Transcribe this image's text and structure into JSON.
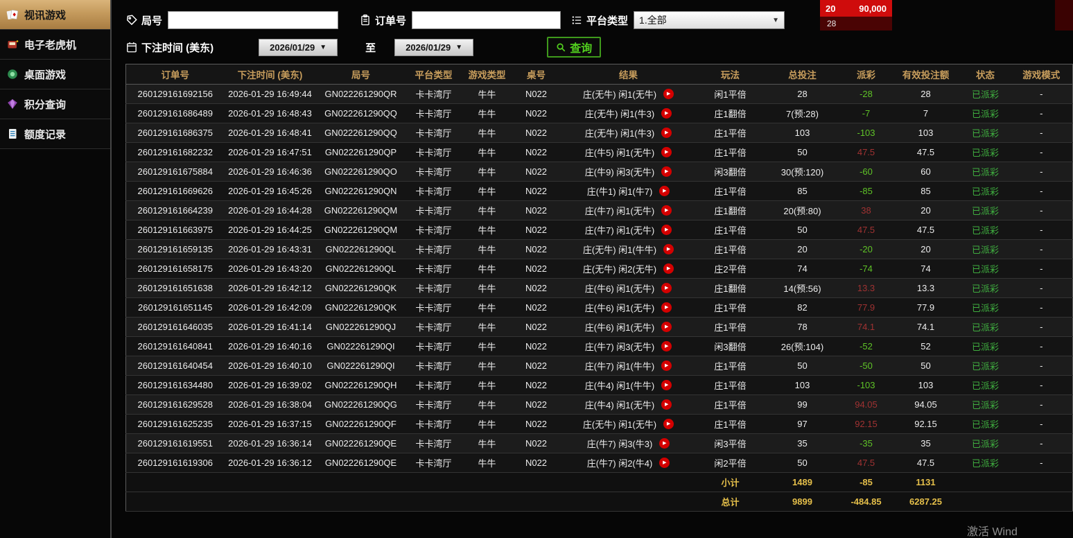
{
  "colors": {
    "accent_gold": "#c79d5c",
    "active_menu_gold": "#c49a5c",
    "win_red": "#a03232",
    "loss_green": "#5fc327",
    "status_green": "#3fae3f",
    "search_green": "#52d01e",
    "play_button_red": "#d40000"
  },
  "sidebar": {
    "items": [
      {
        "label": "视讯游戏"
      },
      {
        "label": "电子老虎机"
      },
      {
        "label": "桌面游戏"
      },
      {
        "label": "积分查询"
      },
      {
        "label": "额度记录"
      }
    ]
  },
  "filters": {
    "round_no_label": "局号",
    "round_no_value": "",
    "order_no_label": "订单号",
    "order_no_value": "",
    "platform_type_label": "平台类型",
    "platform_type_value": "1.全部",
    "bet_time_label": "下注时间 (美东)",
    "date_from": "2026/01/29",
    "to_label": "至",
    "date_to": "2026/01/29",
    "search_button_label": "查询"
  },
  "table": {
    "headers": [
      "订单号",
      "下注时间 (美东)",
      "局号",
      "平台类型",
      "游戏类型",
      "桌号",
      "结果",
      "玩法",
      "总投注",
      "派彩",
      "有效投注额",
      "状态",
      "游戏模式"
    ],
    "column_keys": [
      "order_id",
      "time",
      "round_id",
      "platform",
      "game_type",
      "table_no",
      "result",
      "play_method",
      "total_bet",
      "payout",
      "valid_bet",
      "status",
      "mode"
    ],
    "rows": [
      {
        "order_id": "260129161692156",
        "time": "2026-01-29 16:49:44",
        "round_id": "GN022261290QR",
        "platform": "卡卡湾厅",
        "game_type": "牛牛",
        "table_no": "N022",
        "result": "庄(无牛) 闲1(无牛)",
        "play_method": "闲1平倍",
        "total_bet": "28",
        "payout": "-28",
        "valid_bet": "28",
        "status": "已派彩",
        "mode": "-"
      },
      {
        "order_id": "260129161686489",
        "time": "2026-01-29 16:48:43",
        "round_id": "GN022261290QQ",
        "platform": "卡卡湾厅",
        "game_type": "牛牛",
        "table_no": "N022",
        "result": "庄(无牛) 闲1(牛3)",
        "play_method": "庄1翻倍",
        "total_bet": "7(预:28)",
        "payout": "-7",
        "valid_bet": "7",
        "status": "已派彩",
        "mode": "-"
      },
      {
        "order_id": "260129161686375",
        "time": "2026-01-29 16:48:41",
        "round_id": "GN022261290QQ",
        "platform": "卡卡湾厅",
        "game_type": "牛牛",
        "table_no": "N022",
        "result": "庄(无牛) 闲1(牛3)",
        "play_method": "庄1平倍",
        "total_bet": "103",
        "payout": "-103",
        "valid_bet": "103",
        "status": "已派彩",
        "mode": "-"
      },
      {
        "order_id": "260129161682232",
        "time": "2026-01-29 16:47:51",
        "round_id": "GN022261290QP",
        "platform": "卡卡湾厅",
        "game_type": "牛牛",
        "table_no": "N022",
        "result": "庄(牛5) 闲1(无牛)",
        "play_method": "庄1平倍",
        "total_bet": "50",
        "payout": "47.5",
        "valid_bet": "47.5",
        "status": "已派彩",
        "mode": "-"
      },
      {
        "order_id": "260129161675884",
        "time": "2026-01-29 16:46:36",
        "round_id": "GN022261290QO",
        "platform": "卡卡湾厅",
        "game_type": "牛牛",
        "table_no": "N022",
        "result": "庄(牛9) 闲3(无牛)",
        "play_method": "闲3翻倍",
        "total_bet": "30(预:120)",
        "payout": "-60",
        "valid_bet": "60",
        "status": "已派彩",
        "mode": "-"
      },
      {
        "order_id": "260129161669626",
        "time": "2026-01-29 16:45:26",
        "round_id": "GN022261290QN",
        "platform": "卡卡湾厅",
        "game_type": "牛牛",
        "table_no": "N022",
        "result": "庄(牛1) 闲1(牛7)",
        "play_method": "庄1平倍",
        "total_bet": "85",
        "payout": "-85",
        "valid_bet": "85",
        "status": "已派彩",
        "mode": "-"
      },
      {
        "order_id": "260129161664239",
        "time": "2026-01-29 16:44:28",
        "round_id": "GN022261290QM",
        "platform": "卡卡湾厅",
        "game_type": "牛牛",
        "table_no": "N022",
        "result": "庄(牛7) 闲1(无牛)",
        "play_method": "庄1翻倍",
        "total_bet": "20(预:80)",
        "payout": "38",
        "valid_bet": "20",
        "status": "已派彩",
        "mode": "-"
      },
      {
        "order_id": "260129161663975",
        "time": "2026-01-29 16:44:25",
        "round_id": "GN022261290QM",
        "platform": "卡卡湾厅",
        "game_type": "牛牛",
        "table_no": "N022",
        "result": "庄(牛7) 闲1(无牛)",
        "play_method": "庄1平倍",
        "total_bet": "50",
        "payout": "47.5",
        "valid_bet": "47.5",
        "status": "已派彩",
        "mode": "-"
      },
      {
        "order_id": "260129161659135",
        "time": "2026-01-29 16:43:31",
        "round_id": "GN022261290QL",
        "platform": "卡卡湾厅",
        "game_type": "牛牛",
        "table_no": "N022",
        "result": "庄(无牛) 闲1(牛牛)",
        "play_method": "庄1平倍",
        "total_bet": "20",
        "payout": "-20",
        "valid_bet": "20",
        "status": "已派彩",
        "mode": "-"
      },
      {
        "order_id": "260129161658175",
        "time": "2026-01-29 16:43:20",
        "round_id": "GN022261290QL",
        "platform": "卡卡湾厅",
        "game_type": "牛牛",
        "table_no": "N022",
        "result": "庄(无牛) 闲2(无牛)",
        "play_method": "庄2平倍",
        "total_bet": "74",
        "payout": "-74",
        "valid_bet": "74",
        "status": "已派彩",
        "mode": "-"
      },
      {
        "order_id": "260129161651638",
        "time": "2026-01-29 16:42:12",
        "round_id": "GN022261290QK",
        "platform": "卡卡湾厅",
        "game_type": "牛牛",
        "table_no": "N022",
        "result": "庄(牛6) 闲1(无牛)",
        "play_method": "庄1翻倍",
        "total_bet": "14(预:56)",
        "payout": "13.3",
        "valid_bet": "13.3",
        "status": "已派彩",
        "mode": "-"
      },
      {
        "order_id": "260129161651145",
        "time": "2026-01-29 16:42:09",
        "round_id": "GN022261290QK",
        "platform": "卡卡湾厅",
        "game_type": "牛牛",
        "table_no": "N022",
        "result": "庄(牛6) 闲1(无牛)",
        "play_method": "庄1平倍",
        "total_bet": "82",
        "payout": "77.9",
        "valid_bet": "77.9",
        "status": "已派彩",
        "mode": "-"
      },
      {
        "order_id": "260129161646035",
        "time": "2026-01-29 16:41:14",
        "round_id": "GN022261290QJ",
        "platform": "卡卡湾厅",
        "game_type": "牛牛",
        "table_no": "N022",
        "result": "庄(牛6) 闲1(无牛)",
        "play_method": "庄1平倍",
        "total_bet": "78",
        "payout": "74.1",
        "valid_bet": "74.1",
        "status": "已派彩",
        "mode": "-"
      },
      {
        "order_id": "260129161640841",
        "time": "2026-01-29 16:40:16",
        "round_id": "GN022261290QI",
        "platform": "卡卡湾厅",
        "game_type": "牛牛",
        "table_no": "N022",
        "result": "庄(牛7) 闲3(无牛)",
        "play_method": "闲3翻倍",
        "total_bet": "26(预:104)",
        "payout": "-52",
        "valid_bet": "52",
        "status": "已派彩",
        "mode": "-"
      },
      {
        "order_id": "260129161640454",
        "time": "2026-01-29 16:40:10",
        "round_id": "GN022261290QI",
        "platform": "卡卡湾厅",
        "game_type": "牛牛",
        "table_no": "N022",
        "result": "庄(牛7) 闲1(牛牛)",
        "play_method": "庄1平倍",
        "total_bet": "50",
        "payout": "-50",
        "valid_bet": "50",
        "status": "已派彩",
        "mode": "-"
      },
      {
        "order_id": "260129161634480",
        "time": "2026-01-29 16:39:02",
        "round_id": "GN022261290QH",
        "platform": "卡卡湾厅",
        "game_type": "牛牛",
        "table_no": "N022",
        "result": "庄(牛4) 闲1(牛牛)",
        "play_method": "庄1平倍",
        "total_bet": "103",
        "payout": "-103",
        "valid_bet": "103",
        "status": "已派彩",
        "mode": "-"
      },
      {
        "order_id": "260129161629528",
        "time": "2026-01-29 16:38:04",
        "round_id": "GN022261290QG",
        "platform": "卡卡湾厅",
        "game_type": "牛牛",
        "table_no": "N022",
        "result": "庄(牛4) 闲1(无牛)",
        "play_method": "庄1平倍",
        "total_bet": "99",
        "payout": "94.05",
        "valid_bet": "94.05",
        "status": "已派彩",
        "mode": "-"
      },
      {
        "order_id": "260129161625235",
        "time": "2026-01-29 16:37:15",
        "round_id": "GN022261290QF",
        "platform": "卡卡湾厅",
        "game_type": "牛牛",
        "table_no": "N022",
        "result": "庄(无牛) 闲1(无牛)",
        "play_method": "庄1平倍",
        "total_bet": "97",
        "payout": "92.15",
        "valid_bet": "92.15",
        "status": "已派彩",
        "mode": "-"
      },
      {
        "order_id": "260129161619551",
        "time": "2026-01-29 16:36:14",
        "round_id": "GN022261290QE",
        "platform": "卡卡湾厅",
        "game_type": "牛牛",
        "table_no": "N022",
        "result": "庄(牛7) 闲3(牛3)",
        "play_method": "闲3平倍",
        "total_bet": "35",
        "payout": "-35",
        "valid_bet": "35",
        "status": "已派彩",
        "mode": "-"
      },
      {
        "order_id": "260129161619306",
        "time": "2026-01-29 16:36:12",
        "round_id": "GN022261290QE",
        "platform": "卡卡湾厅",
        "game_type": "牛牛",
        "table_no": "N022",
        "result": "庄(牛7) 闲2(牛4)",
        "play_method": "闲2平倍",
        "total_bet": "50",
        "payout": "47.5",
        "valid_bet": "47.5",
        "status": "已派彩",
        "mode": "-"
      }
    ],
    "subtotal": {
      "label": "小计",
      "total_bet": "1489",
      "payout": "-85",
      "valid_bet": "1131"
    },
    "grand_total": {
      "label": "总计",
      "total_bet": "9899",
      "payout": "-484.85",
      "valid_bet": "6287.25"
    }
  },
  "background": {
    "top_badge_left": "20",
    "top_badge_right": "90,000",
    "top_badge_line2": "28",
    "watermark": "激活 Wind"
  }
}
